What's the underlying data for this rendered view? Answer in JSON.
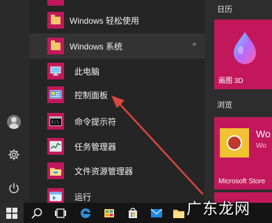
{
  "start_menu": {
    "list": {
      "items": [
        {
          "label": "Windows 轻松使用",
          "kind": "folder"
        },
        {
          "label": "Windows 系统",
          "kind": "folder",
          "expanded": true,
          "chevron": "^"
        }
      ],
      "sub_items": [
        {
          "label": "此电脑",
          "icon": "this-pc-icon"
        },
        {
          "label": "控制面板",
          "icon": "control-panel-icon"
        },
        {
          "label": "命令提示符",
          "icon": "command-prompt-icon"
        },
        {
          "label": "任务管理器",
          "icon": "task-manager-icon"
        },
        {
          "label": "文件资源管理器",
          "icon": "file-explorer-icon"
        },
        {
          "label": "运行",
          "icon": "run-icon"
        }
      ]
    },
    "tiles": {
      "groups": [
        {
          "label": "日历"
        },
        {
          "label": "浏览"
        }
      ],
      "paint3d_label": "画图 3D",
      "store_title": "Wo",
      "store_subtitle": "Wo",
      "store_label": "Microsoft Store"
    }
  },
  "taskbar": {
    "icons": [
      "windows-start-icon",
      "search-icon",
      "task-view-icon",
      "edge-icon",
      "store-icon",
      "store-bag-icon",
      "mail-icon",
      "explorer-icon"
    ]
  },
  "watermark": "广东龙网",
  "colors": {
    "accent": "#c2185b",
    "list_bg": "#252525",
    "rail_bg": "#2a2a2a",
    "taskbar_bg": "#141414",
    "arrow": "#d9473a"
  }
}
